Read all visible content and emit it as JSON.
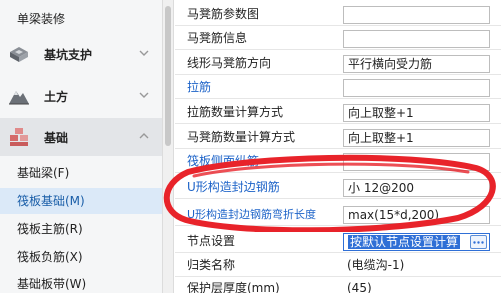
{
  "sidebar": {
    "top_item": "单梁装修",
    "categories": [
      {
        "label": "基坑支护",
        "icon": "excavation-icon"
      },
      {
        "label": "土方",
        "icon": "earthwork-icon"
      },
      {
        "label": "基础",
        "icon": "foundation-icon"
      }
    ],
    "items": [
      "基础梁(F)",
      "筏板基础(M)",
      "筏板主筋(R)",
      "筏板负筋(X)",
      "基础板带(W)"
    ],
    "selected_item": "筏板基础(M)"
  },
  "properties": {
    "rows": [
      {
        "label": "马凳筋参数图",
        "value": ""
      },
      {
        "label": "马凳筋信息",
        "value": ""
      },
      {
        "label": "线形马凳筋方向",
        "value": "平行横向受力筋"
      },
      {
        "label": "拉筋",
        "value": ""
      },
      {
        "label": "拉筋数量计算方式",
        "value": "向上取整+1"
      },
      {
        "label": "马凳筋数量计算方式",
        "value": "向上取整+1"
      },
      {
        "label": "筏板侧面纵筋",
        "value": ""
      },
      {
        "label": "U形构造封边钢筋",
        "value": "⼩ 12@200"
      },
      {
        "label": "U形构造封边钢筋弯折长度",
        "value": "max(15*d,200)"
      },
      {
        "label": "节点设置",
        "value": "按默认节点设置计算"
      },
      {
        "label": "归类名称",
        "value": "(电缆沟-1)"
      },
      {
        "label": "保护层厚度(mm)",
        "value": "(45)"
      }
    ]
  },
  "colors": {
    "annotation": "#e8232a",
    "link_label": "#1d63c8",
    "selection": "#2f6fd6"
  }
}
